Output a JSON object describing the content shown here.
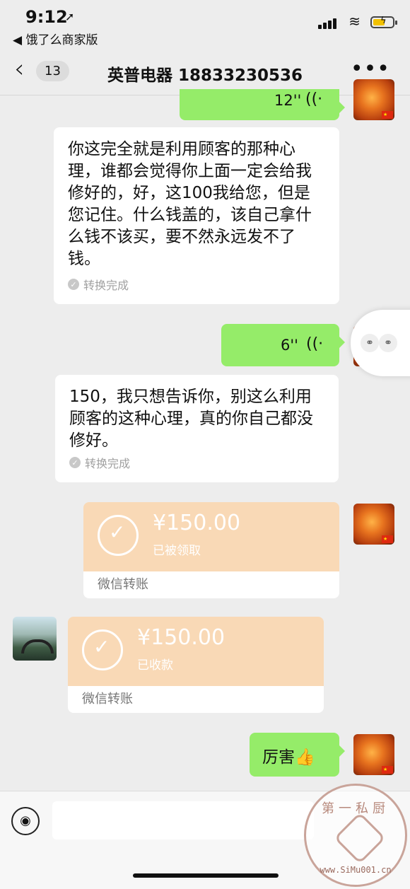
{
  "status_bar": {
    "time": "9:12",
    "back_app": "◀ 饿了么商家版"
  },
  "nav": {
    "unread": "13",
    "title": "英普电器 18833230536",
    "more": "•••"
  },
  "messages": {
    "voice1": {
      "duration": "12''"
    },
    "text1": {
      "content": "你这完全就是利用顾客的那种心理，谁都会觉得你上面一定会给我修好的，好，这100我给您，但是您记住。什么钱盖的，该自己拿什么钱不该买，要不然永远发不了钱。",
      "status": "转换完成"
    },
    "voice2": {
      "duration": "6''"
    },
    "text2": {
      "content": "150，我只想告诉你，别这么利用顾客的这种心理，真的你自己都没修好。",
      "status": "转换完成"
    },
    "transfer1": {
      "amount": "¥150.00",
      "status": "已被领取",
      "label": "微信转账"
    },
    "transfer2": {
      "amount": "¥150.00",
      "status": "已收款",
      "label": "微信转账"
    },
    "text3": {
      "content": "厉害👍"
    }
  },
  "watermark": {
    "text": "第一私厨",
    "url": "www.SiMu001.cn"
  },
  "colors": {
    "sent_bubble": "#95ec69",
    "transfer": "#f9d9b6",
    "background": "#ededed"
  }
}
